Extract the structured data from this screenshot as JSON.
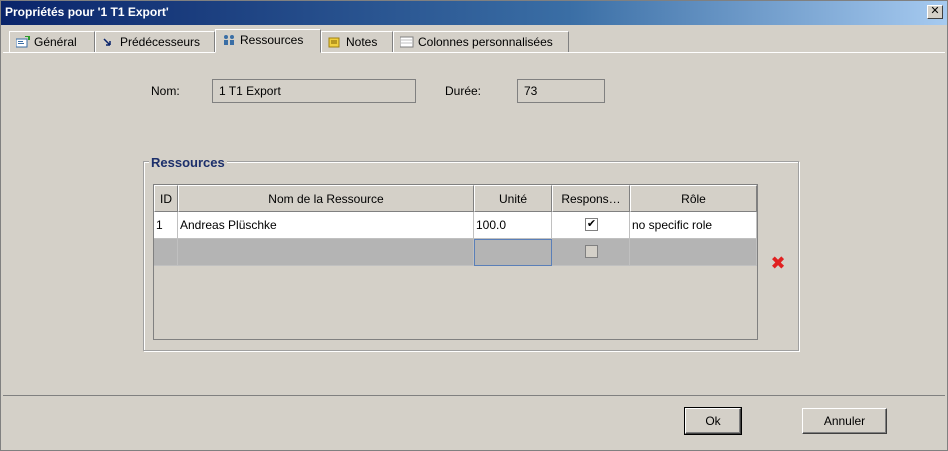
{
  "window": {
    "title": "Propriétés pour '1 T1 Export'",
    "close_glyph": "✕"
  },
  "tabs": [
    {
      "label": "Général",
      "icon": "general-icon"
    },
    {
      "label": "Prédécesseurs",
      "icon": "predecessors-icon"
    },
    {
      "label": "Ressources",
      "icon": "resources-icon",
      "active": true
    },
    {
      "label": "Notes",
      "icon": "notes-icon"
    },
    {
      "label": "Colonnes personnalisées",
      "icon": "columns-icon"
    }
  ],
  "form": {
    "name_label": "Nom:",
    "name_value": "1 T1 Export",
    "duration_label": "Durée:",
    "duration_value": "73"
  },
  "resources": {
    "group_title": "Ressources",
    "columns": [
      "ID",
      "Nom de la Ressource",
      "Unité",
      "Respons…",
      "Rôle"
    ],
    "rows": [
      {
        "id": "1",
        "name": "Andreas Plüschke",
        "unit": "100.0",
        "responsible": true,
        "role": "no specific role"
      },
      {
        "id": "",
        "name": "",
        "unit": "",
        "responsible": false,
        "role": ""
      }
    ]
  },
  "buttons": {
    "ok": "Ok",
    "cancel": "Annuler"
  },
  "colors": {
    "titlebar": "#0a246a",
    "dialog_bg": "#d4d0c8",
    "delete_icon": "#e02020"
  }
}
